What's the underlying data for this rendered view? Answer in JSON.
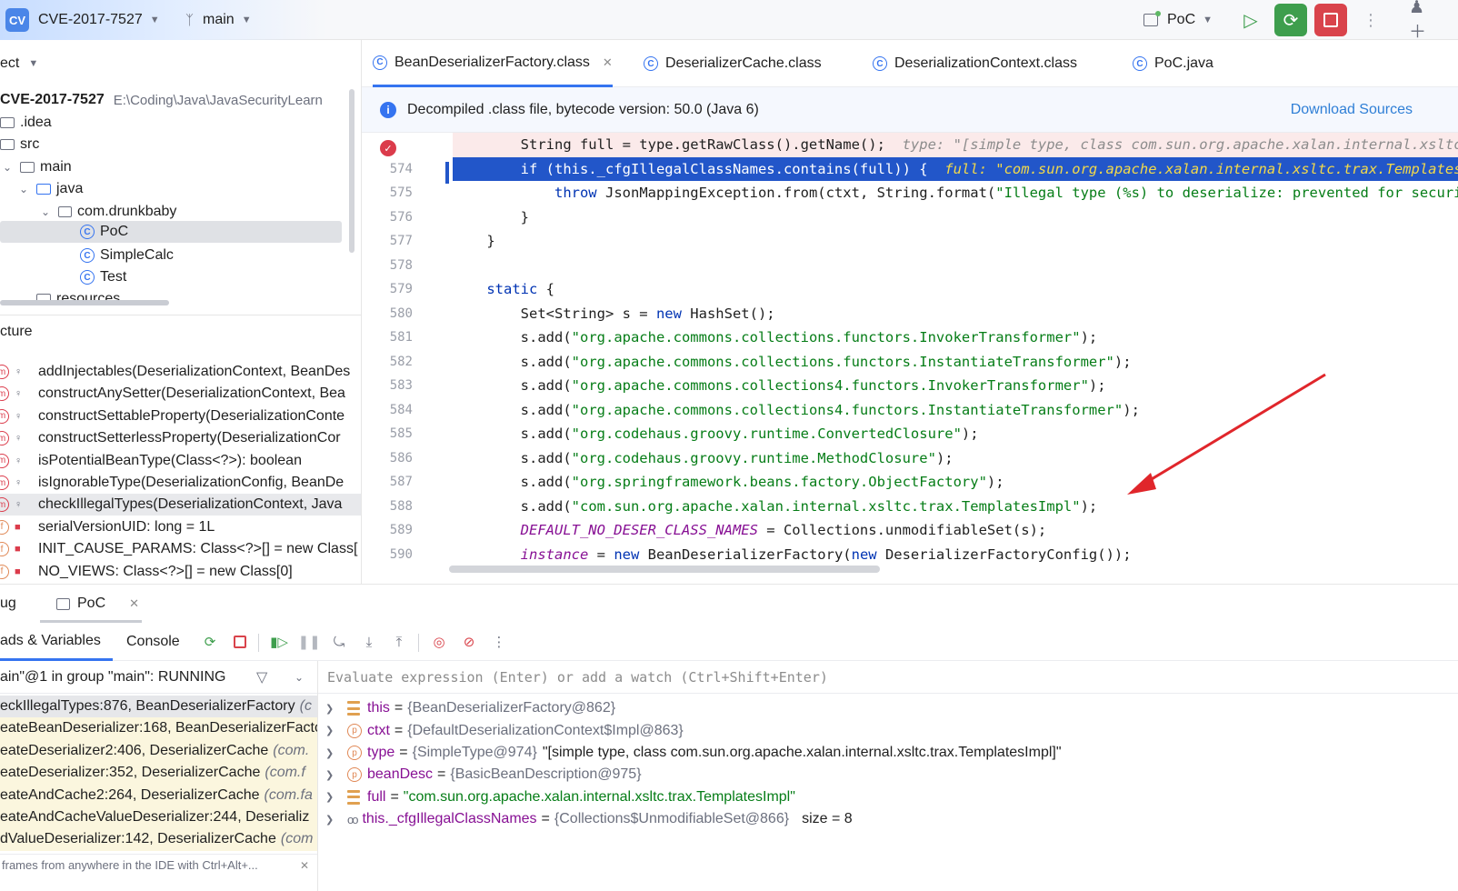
{
  "toolbar": {
    "project_badge": "CV",
    "project_name": "CVE-2017-7527",
    "branch": "main",
    "run_config": "PoC"
  },
  "project_panel": {
    "title": "ect",
    "root_name": "CVE-2017-7527",
    "root_path": "E:\\Coding\\Java\\JavaSecurityLearn",
    "items": [
      {
        "label": ".idea",
        "type": "folder"
      },
      {
        "label": "src",
        "type": "folder"
      },
      {
        "label": "main",
        "type": "folder"
      },
      {
        "label": "java",
        "type": "folder"
      },
      {
        "label": "com.drunkbaby",
        "type": "package"
      },
      {
        "label": "PoC",
        "type": "class"
      },
      {
        "label": "SimpleCalc",
        "type": "class"
      },
      {
        "label": "Test",
        "type": "class"
      },
      {
        "label": "resources",
        "type": "folder"
      }
    ]
  },
  "structure_panel": {
    "title": "cture",
    "items": [
      {
        "label": "addInjectables(DeserializationContext, BeanDes",
        "kind": "m"
      },
      {
        "label": "constructAnySetter(DeserializationContext, Bea",
        "kind": "m"
      },
      {
        "label": "constructSettableProperty(DeserializationConte",
        "kind": "m"
      },
      {
        "label": "constructSetterlessProperty(DeserializationCor",
        "kind": "m"
      },
      {
        "label": "isPotentialBeanType(Class<?>): boolean",
        "kind": "m"
      },
      {
        "label": "isIgnorableType(DeserializationConfig, BeanDe",
        "kind": "m"
      },
      {
        "label": "checkIllegalTypes(DeserializationContext, Java",
        "kind": "m"
      },
      {
        "label": "serialVersionUID: long = 1L",
        "kind": "f"
      },
      {
        "label": "INIT_CAUSE_PARAMS: Class<?>[] = new Class[",
        "kind": "f"
      },
      {
        "label": "NO_VIEWS: Class<?>[] = new Class[0]",
        "kind": "f"
      }
    ]
  },
  "editor": {
    "tabs": [
      {
        "label": "BeanDeserializerFactory.class",
        "active": true
      },
      {
        "label": "DeserializerCache.class",
        "active": false
      },
      {
        "label": "DeserializationContext.class",
        "active": false
      },
      {
        "label": "PoC.java",
        "active": false
      }
    ],
    "banner_text": "Decompiled .class file, bytecode version: 50.0 (Java 6)",
    "banner_action": "Download Sources",
    "line_numbers": [
      "",
      "574",
      "575",
      "576",
      "577",
      "578",
      "579",
      "580",
      "581",
      "582",
      "583",
      "584",
      "585",
      "586",
      "587",
      "588",
      "589",
      "590"
    ],
    "code": {
      "l0_code": "        String full = type.getRawClass().getName();",
      "l0_hint": "  type: \"[simple type, class com.sun.org.apache.xalan.internal.xsltc.trax.TemplatesImpl]\"",
      "l1_code": "        if (this._cfgIllegalClassNames.contains(full)) {",
      "l1_hint": "  full: \"com.sun.org.apache.xalan.internal.xsltc.trax.TemplatesImpl\"",
      "l2_kw": "throw",
      "l2_code": " JsonMappingException.from(ctxt, String.format(",
      "l2_str": "\"Illegal type (%s) to deserialize: prevented for security reasons\"",
      "l3": "        }",
      "l4": "    }",
      "l6_kw": "static",
      "l6_rest": " {",
      "l7_a": "        Set<String> s = ",
      "l7_kw": "new",
      "l7_b": " HashSet();",
      "adds": [
        "\"org.apache.commons.collections.functors.InvokerTransformer\"",
        "\"org.apache.commons.collections.functors.InstantiateTransformer\"",
        "\"org.apache.commons.collections4.functors.InvokerTransformer\"",
        "\"org.apache.commons.collections4.functors.InstantiateTransformer\"",
        "\"org.codehaus.groovy.runtime.ConvertedClosure\"",
        "\"org.codehaus.groovy.runtime.MethodClosure\"",
        "\"org.springframework.beans.factory.ObjectFactory\"",
        "\"com.sun.org.apache.xalan.internal.xsltc.trax.TemplatesImpl\""
      ],
      "add_prefix": "        s.add(",
      "add_suffix": ");",
      "l16_field": "DEFAULT_NO_DESER_CLASS_NAMES",
      "l16_rest": " = Collections.unmodifiableSet(s);",
      "l17_field": "instance",
      "l17_eq": " = ",
      "l17_kw1": "new",
      "l17_mid": " BeanDeserializerFactory(",
      "l17_kw2": "new",
      "l17_end": " DeserializerFactoryConfig());"
    }
  },
  "debug": {
    "title": "ug",
    "session_tab": "PoC",
    "tabs": [
      {
        "label": "ads & Variables",
        "active": true
      },
      {
        "label": "Console",
        "active": false
      }
    ],
    "thread_status": "ain\"@1 in group \"main\": RUNNING",
    "frames": [
      {
        "method": "eckIllegalTypes:876, BeanDeserializerFactory",
        "cls": "(c"
      },
      {
        "method": "eateBeanDeserializer:168, BeanDeserializerFacto",
        "cls": ""
      },
      {
        "method": "eateDeserializer2:406, DeserializerCache",
        "cls": "(com."
      },
      {
        "method": "eateDeserializer:352, DeserializerCache",
        "cls": "(com.f"
      },
      {
        "method": "eateAndCache2:264, DeserializerCache",
        "cls": "(com.fa"
      },
      {
        "method": "eateAndCacheValueDeserializer:244, Deserializ",
        "cls": ""
      },
      {
        "method": "dValueDeserializer:142, DeserializerCache",
        "cls": "(com"
      }
    ],
    "frames_hint": "frames from anywhere in the IDE with Ctrl+Alt+...",
    "eval_placeholder": "Evaluate expression (Enter) or add a watch (Ctrl+Shift+Enter)",
    "variables": [
      {
        "icon": "list",
        "name": "this",
        "type": "{BeanDeserializerFactory@862}",
        "value": "",
        "extra": ""
      },
      {
        "icon": "p",
        "name": "ctxt",
        "type": "{DefaultDeserializationContext$Impl@863}",
        "value": "",
        "extra": ""
      },
      {
        "icon": "p",
        "name": "type",
        "type": "{SimpleType@974}",
        "value": "\"[simple type, class com.sun.org.apache.xalan.internal.xsltc.trax.TemplatesImpl]\"",
        "extra": ""
      },
      {
        "icon": "p",
        "name": "beanDesc",
        "type": "{BasicBeanDescription@975}",
        "value": "",
        "extra": ""
      },
      {
        "icon": "list",
        "name": "full",
        "type": "",
        "value": "\"com.sun.org.apache.xalan.internal.xsltc.trax.TemplatesImpl\"",
        "extra": ""
      },
      {
        "icon": "oo",
        "name": "this._cfgIllegalClassNames",
        "type": "{Collections$UnmodifiableSet@866}",
        "value": "",
        "extra": "size = 8"
      }
    ]
  }
}
